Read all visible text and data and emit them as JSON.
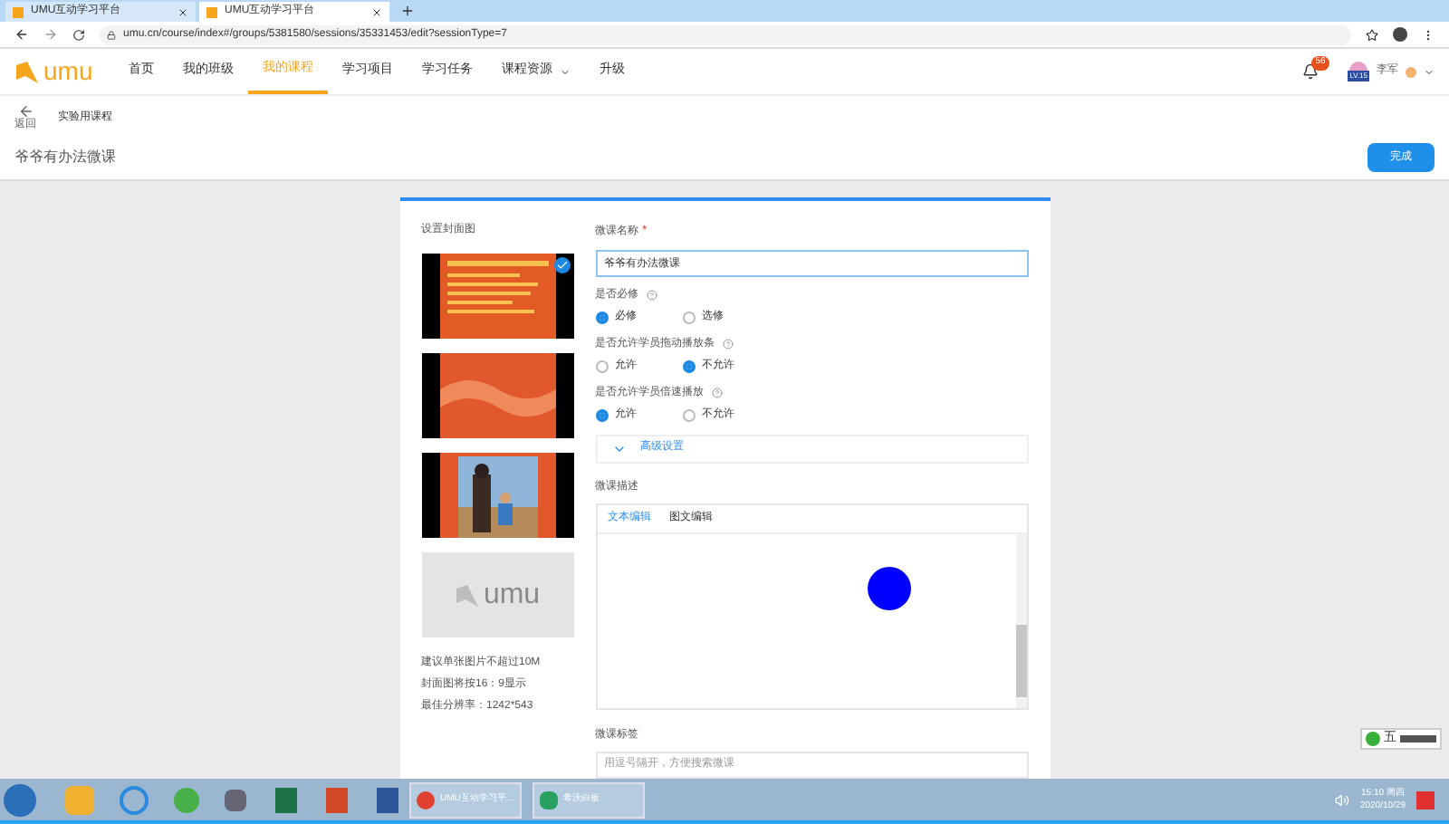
{
  "browser": {
    "tabs": [
      {
        "label": "UMU互动学习平台",
        "selected": false
      },
      {
        "label": "UMU互动学习平台",
        "selected": true
      }
    ],
    "url": "umu.cn/course/index#/groups/5381580/sessions/35331453/edit?sessionType=7"
  },
  "nav": {
    "logo": "umu",
    "items": [
      {
        "label": "首页",
        "selected": false
      },
      {
        "label": "我的班级",
        "selected": false
      },
      {
        "label": "我的课程",
        "selected": true
      },
      {
        "label": "学习项目",
        "selected": false
      },
      {
        "label": "学习任务",
        "selected": false
      },
      {
        "label": "课程资源",
        "selected": false,
        "dropdown": true
      },
      {
        "label": "升级",
        "selected": false
      }
    ],
    "badge": "56",
    "level": "LV.15",
    "user": "李军"
  },
  "breadcrumb": {
    "back": "返回",
    "course": "实验用课程"
  },
  "title": "爷爷有办法微课",
  "done_button": "完成",
  "cover": {
    "label": "设置封面图",
    "images": [
      {
        "kind": "slide",
        "selected": true
      },
      {
        "kind": "pattern",
        "selected": false
      },
      {
        "kind": "picture",
        "selected": false
      },
      {
        "kind": "placeholder",
        "selected": false
      }
    ],
    "placeholder_logo": "umu",
    "hints": [
      "建议单张图片不超过10M",
      "封面图将按16：9显示",
      "最佳分辨率：1242*543"
    ]
  },
  "form": {
    "name_label": "微课名称",
    "required_mark": "*",
    "name_value": "爷爷有办法微课",
    "radio_groups": [
      {
        "label": "是否必修",
        "options": [
          {
            "label": "必修",
            "selected": true
          },
          {
            "label": "选修",
            "selected": false
          }
        ]
      },
      {
        "label": "是否允许学员拖动播放条",
        "options": [
          {
            "label": "允许",
            "selected": false
          },
          {
            "label": "不允许",
            "selected": true
          }
        ]
      },
      {
        "label": "是否允许学员倍速播放",
        "options": [
          {
            "label": "允许",
            "selected": true
          },
          {
            "label": "不允许",
            "selected": false
          }
        ]
      }
    ],
    "advanced": "高级设置",
    "desc_label": "微课描述",
    "desc_tabs": [
      {
        "label": "文本编辑",
        "selected": true
      },
      {
        "label": "图文编辑",
        "selected": false
      }
    ],
    "tag_label": "微课标签",
    "tag_placeholder": "用逗号隔开，方便搜索微课"
  },
  "taskbar": {
    "apps": [
      {
        "kind": "chrome",
        "label": "UMU互动学习平..."
      },
      {
        "kind": "en",
        "label": "希沃白板"
      }
    ],
    "time": "15:10 周四",
    "date": "2020/10/29"
  },
  "ime": {
    "label": "五"
  }
}
